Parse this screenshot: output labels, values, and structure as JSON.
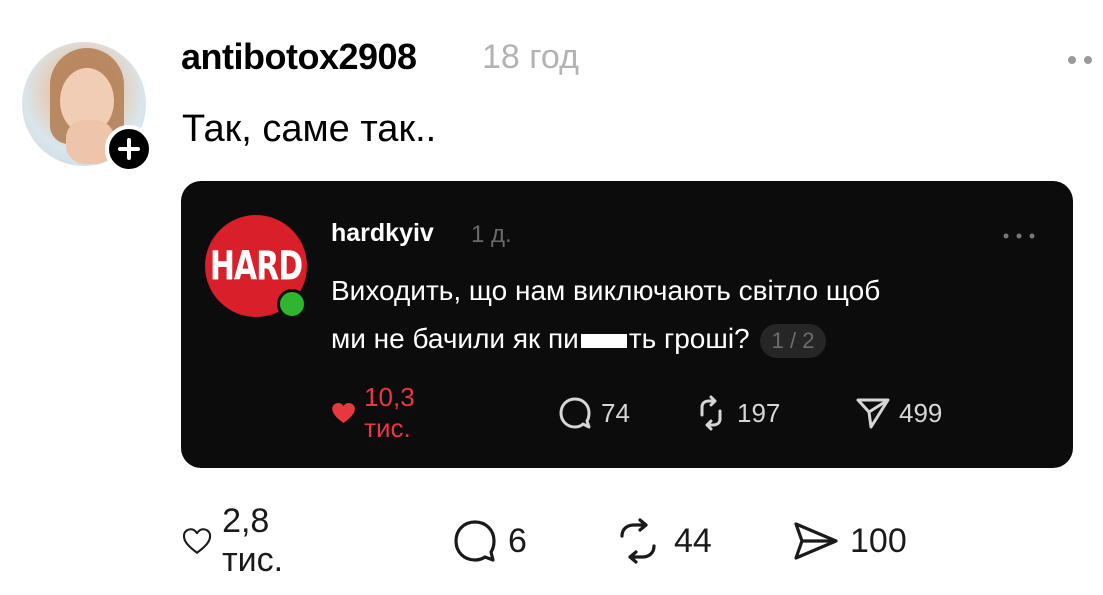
{
  "post": {
    "username": "antibotox2908",
    "time": "18 год",
    "text": "Так, саме так..",
    "actions": {
      "likes": "2,8 тис.",
      "replies": "6",
      "reposts": "44",
      "shares": "100"
    }
  },
  "quoted": {
    "username": "hardkyiv",
    "time": "1 д.",
    "avatar_text": "HARD",
    "text_line1": "Виходить, що нам виключають світло щоб",
    "text_line2_a": "ми не бачили як пи",
    "text_line2_b": "ть гроші?",
    "page_indicator": "1 / 2",
    "actions": {
      "likes": "10,3 тис.",
      "replies": "74",
      "reposts": "197",
      "shares": "499"
    }
  },
  "colors": {
    "like_active": "#e8373f",
    "quote_bg": "#0c0c0c",
    "online_dot": "#2fb52f",
    "hard_logo": "#d81f2a"
  }
}
